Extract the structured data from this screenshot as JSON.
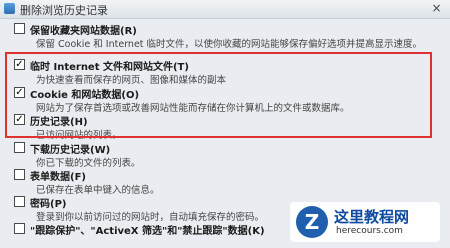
{
  "dialog": {
    "title": "删除浏览历史记录",
    "close_glyph": "×"
  },
  "items": [
    {
      "label": "保留收藏夹网站数据(R)",
      "desc": "保留 Cookie 和 Internet 临时文件，以使你收藏的网站能够保存偏好选项并提高显示速度。",
      "checked": false
    },
    {
      "label": "临时 Internet 文件和网站文件(T)",
      "desc": "为快速查看而保存的网页、图像和媒体的副本",
      "checked": true
    },
    {
      "label": "Cookie 和网站数据(O)",
      "desc": "网站为了保存首选项或改善网站性能而存储在你计算机上的文件或数据库。",
      "checked": true
    },
    {
      "label": "历史记录(H)",
      "desc": "已访问网站的列表。",
      "checked": true
    },
    {
      "label": "下载历史记录(W)",
      "desc": "你已下载的文件的列表。",
      "checked": false
    },
    {
      "label": "表单数据(F)",
      "desc": "已保存在表单中键入的信息。",
      "checked": false
    },
    {
      "label": "密码(P)",
      "desc": "登录到你以前访问过的网站时，自动填充保存的密码。",
      "checked": false
    },
    {
      "label": "\"跟踪保护\"、\"ActiveX 筛选\"和\"禁止跟踪\"数据(K)",
      "desc": "",
      "checked": false
    }
  ],
  "highlight_color": "#e03030",
  "watermark": {
    "mark": "Z",
    "name": "这里教程网",
    "url": "herecours.com"
  }
}
